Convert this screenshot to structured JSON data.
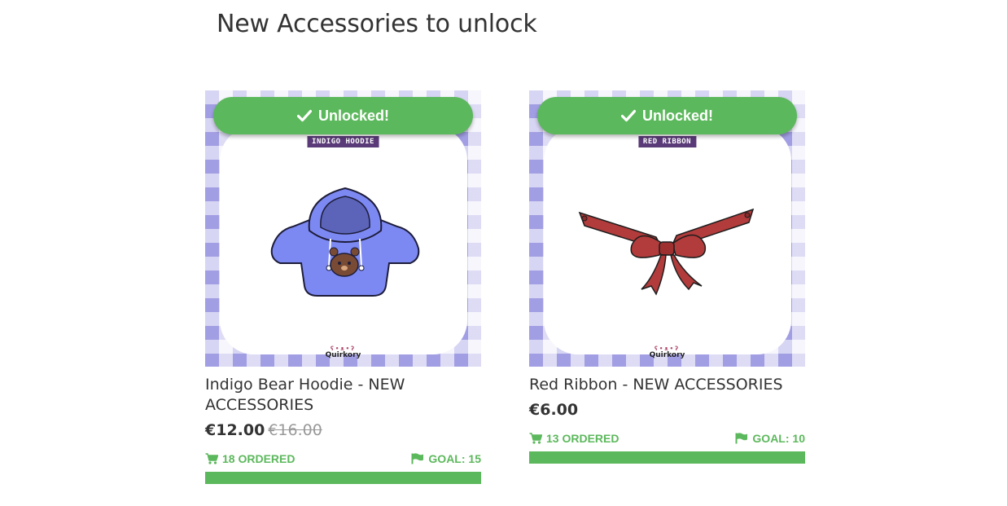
{
  "section": {
    "title": "New Accessories to unlock"
  },
  "colors": {
    "accent_green": "#5cb85c",
    "pattern_purple": "#9e9ae2",
    "price_text": "#333333",
    "old_price": "#999999"
  },
  "products": [
    {
      "banner": "Unlocked!",
      "image_tag": "INDIGO HOODIE",
      "brand": "Quirkory",
      "title": "Indigo Bear Hoodie - NEW ACCESSORIES",
      "price": "€12.00",
      "old_price": "€16.00",
      "ordered": "18 ORDERED",
      "goal": "GOAL: 15",
      "progress_fraction": 1.0,
      "icons": {
        "banner": "check-icon",
        "ordered": "cart-icon",
        "goal": "flag-icon"
      }
    },
    {
      "banner": "Unlocked!",
      "image_tag": "RED RIBBON",
      "brand": "Quirkory",
      "title": "Red Ribbon - NEW ACCESSORIES",
      "price": "€6.00",
      "ordered": "13 ORDERED",
      "goal": "GOAL: 10",
      "progress_fraction": 1.0,
      "icons": {
        "banner": "check-icon",
        "ordered": "cart-icon",
        "goal": "flag-icon"
      }
    }
  ]
}
